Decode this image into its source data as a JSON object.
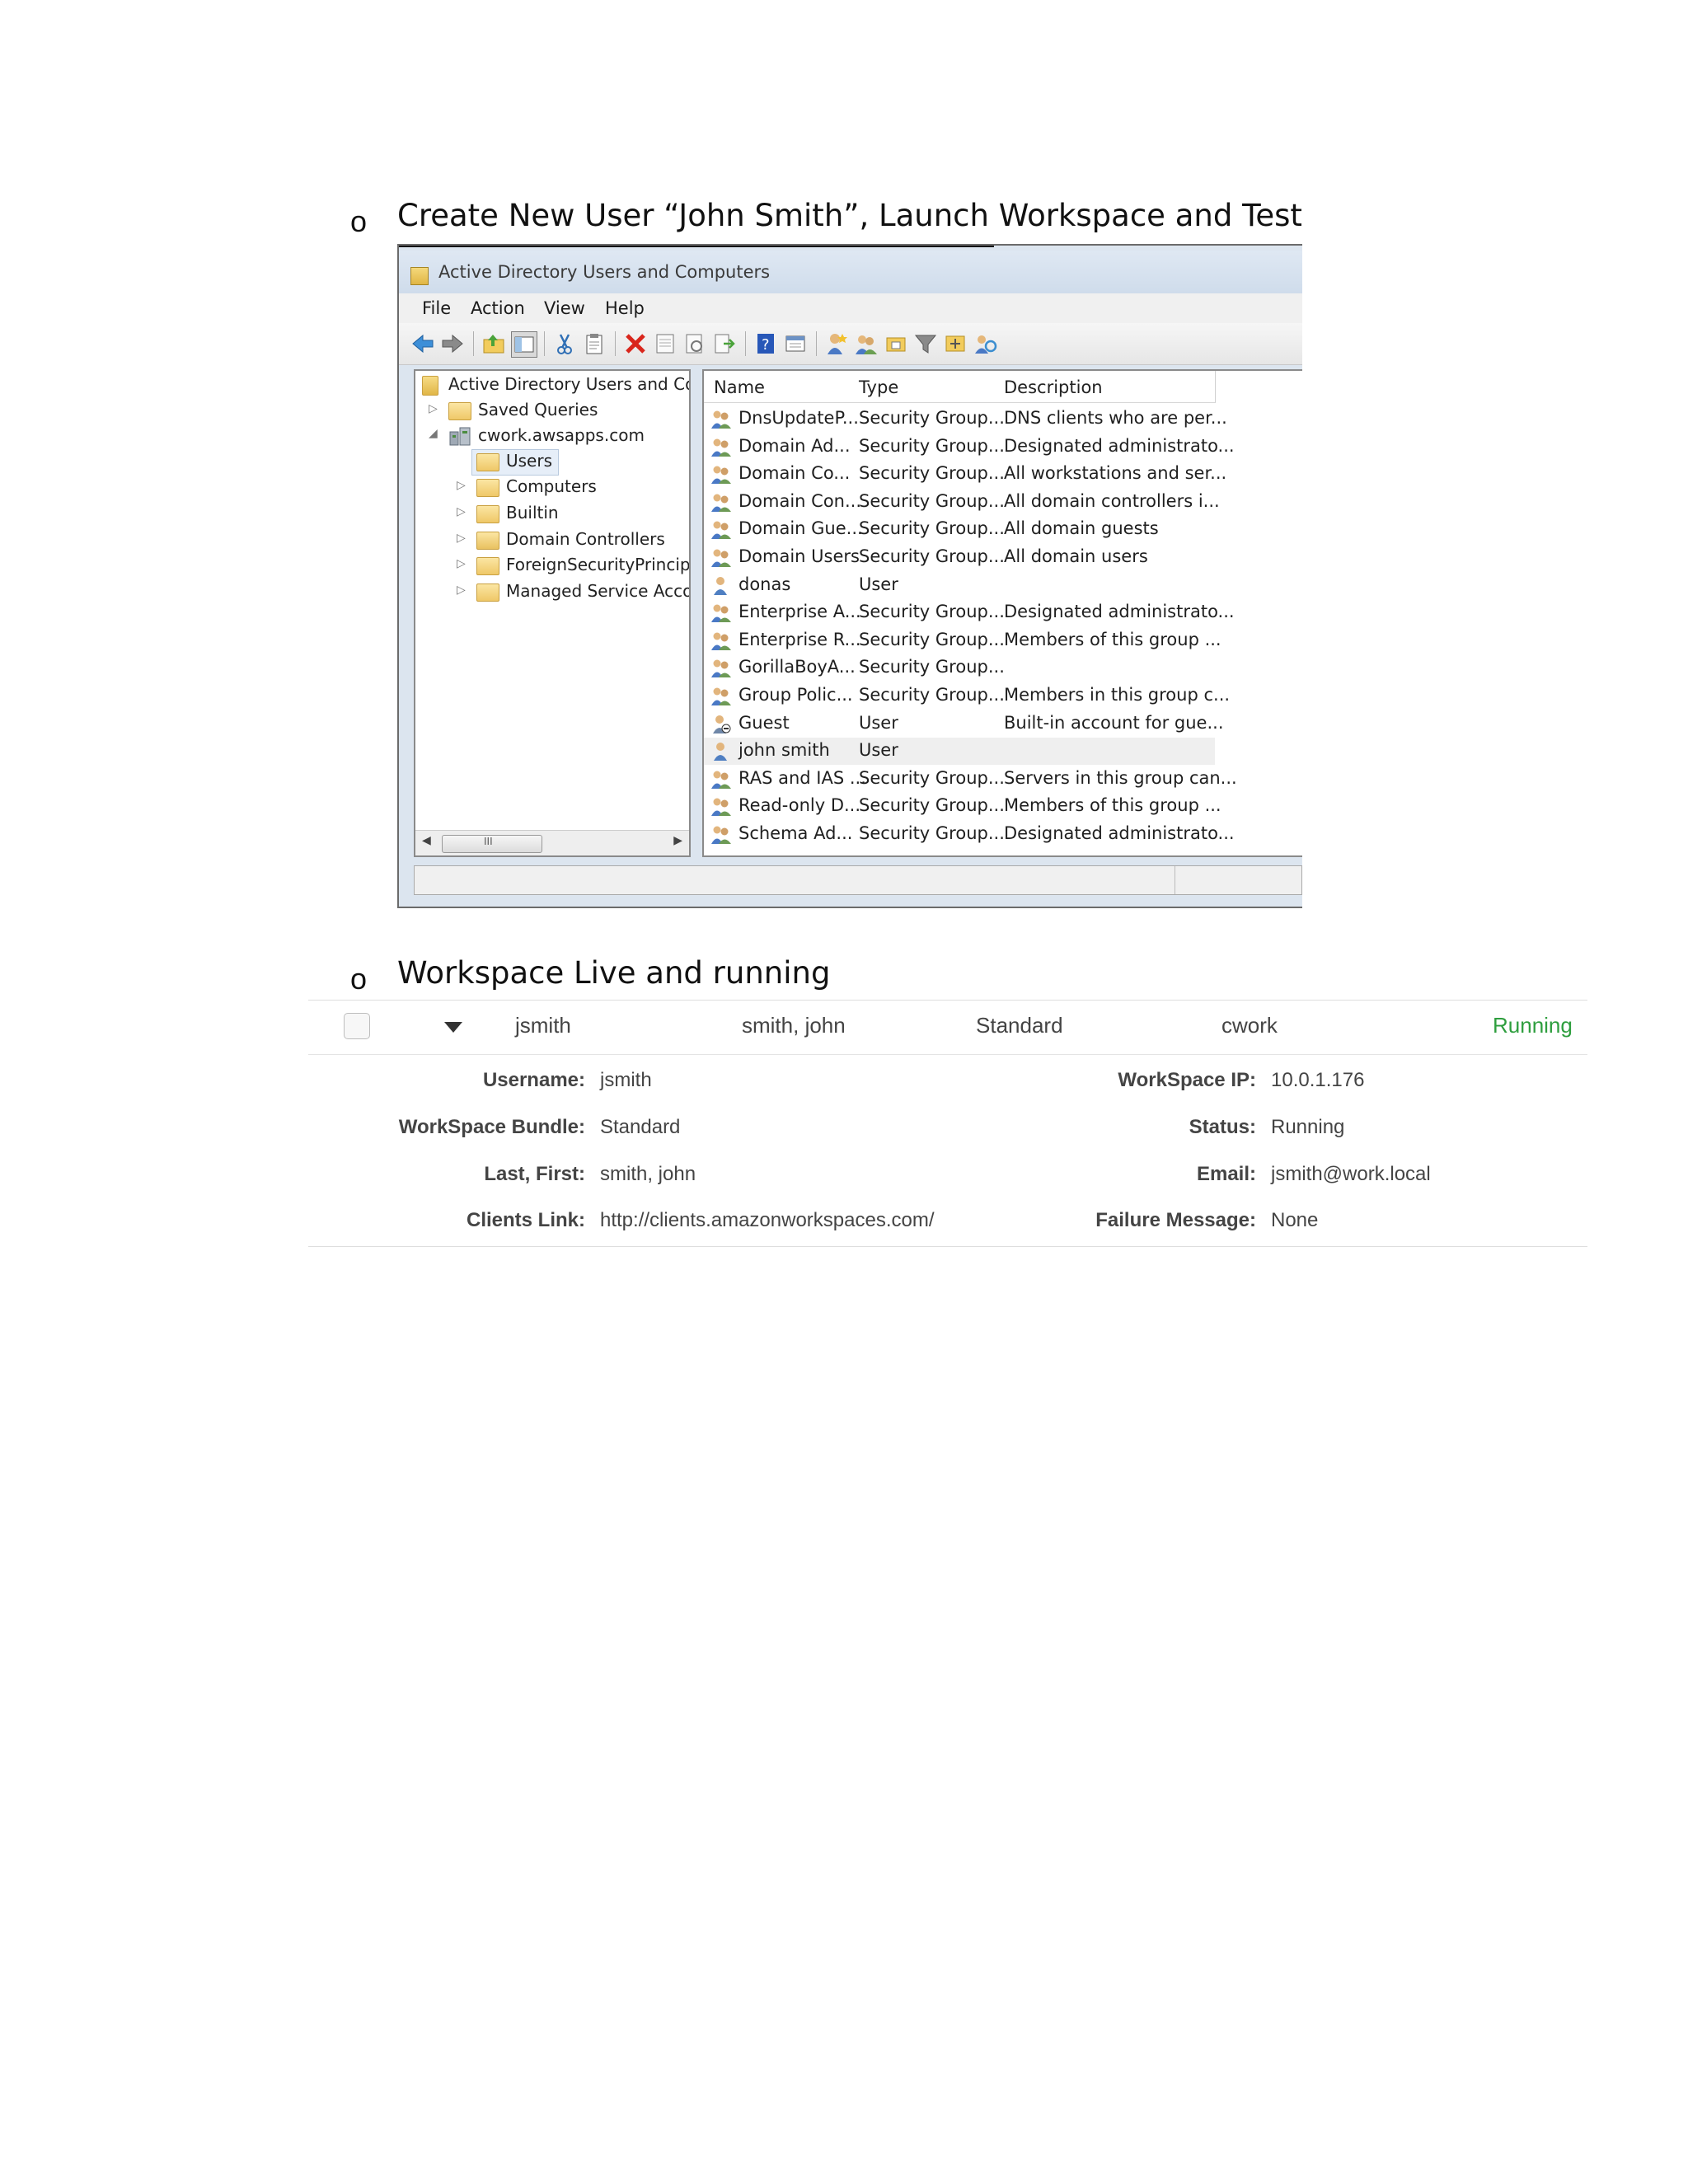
{
  "section1": {
    "bullet": "o",
    "heading": "Create New User “John Smith”, Launch Workspace and Test"
  },
  "aduc": {
    "title": "Active Directory Users and Computers",
    "menu": [
      "File",
      "Action",
      "View",
      "Help"
    ],
    "tree": {
      "root": "Active Directory Users and Com",
      "saved_queries": "Saved Queries",
      "domain": "cwork.awsapps.com",
      "children": [
        "Users",
        "Computers",
        "Builtin",
        "Domain Controllers",
        "ForeignSecurityPrincipal:",
        "Managed Service Accour"
      ],
      "selected": "Users"
    },
    "columns": [
      "Name",
      "Type",
      "Description"
    ],
    "rows": [
      {
        "name": "DnsUpdateP...",
        "type": "Security Group...",
        "description": "DNS clients who are per...",
        "icon": "group-icon"
      },
      {
        "name": "Domain Ad...",
        "type": "Security Group...",
        "description": "Designated administrato...",
        "icon": "group-icon"
      },
      {
        "name": "Domain Co...",
        "type": "Security Group...",
        "description": "All workstations and ser...",
        "icon": "group-icon"
      },
      {
        "name": "Domain Con...",
        "type": "Security Group...",
        "description": "All domain controllers i...",
        "icon": "group-icon"
      },
      {
        "name": "Domain Gue...",
        "type": "Security Group...",
        "description": "All domain guests",
        "icon": "group-icon"
      },
      {
        "name": "Domain Users",
        "type": "Security Group...",
        "description": "All domain users",
        "icon": "group-icon"
      },
      {
        "name": "donas",
        "type": "User",
        "description": "",
        "icon": "user-icon"
      },
      {
        "name": "Enterprise A...",
        "type": "Security Group...",
        "description": "Designated administrato...",
        "icon": "group-icon"
      },
      {
        "name": "Enterprise R...",
        "type": "Security Group...",
        "description": "Members of this group ...",
        "icon": "group-icon"
      },
      {
        "name": "GorillaBoyA...",
        "type": "Security Group...",
        "description": "",
        "icon": "group-icon"
      },
      {
        "name": "Group Polic...",
        "type": "Security Group...",
        "description": "Members in this group c...",
        "icon": "group-icon"
      },
      {
        "name": "Guest",
        "type": "User",
        "description": "Built-in account for gue...",
        "icon": "disabled-user-icon"
      },
      {
        "name": "john smith",
        "type": "User",
        "description": "",
        "icon": "user-icon",
        "selected": true
      },
      {
        "name": "RAS and IAS ...",
        "type": "Security Group...",
        "description": "Servers in this group can...",
        "icon": "group-icon"
      },
      {
        "name": "Read-only D...",
        "type": "Security Group...",
        "description": "Members of this group ...",
        "icon": "group-icon"
      },
      {
        "name": "Schema Ad...",
        "type": "Security Group...",
        "description": "Designated administrato...",
        "icon": "group-icon"
      }
    ],
    "scroll_grip": "III"
  },
  "section2": {
    "bullet": "o",
    "heading": "Workspace Live and running"
  },
  "workspace": {
    "row": {
      "username": "jsmith",
      "name": "smith, john",
      "bundle": "Standard",
      "directory": "cwork",
      "status": "Running"
    },
    "details": {
      "username_label": "Username:",
      "username": "jsmith",
      "bundle_label": "WorkSpace Bundle:",
      "bundle": "Standard",
      "lastfirst_label": "Last, First:",
      "lastfirst": "smith, john",
      "clients_label": "Clients Link:",
      "clients": "http://clients.amazonworkspaces.com/",
      "ip_label": "WorkSpace IP:",
      "ip": "10.0.1.176",
      "status_label": "Status:",
      "status": "Running",
      "email_label": "Email:",
      "email": "jsmith@work.local",
      "failure_label": "Failure Message:",
      "failure": "None"
    },
    "status_color": "#2e9e3e"
  }
}
